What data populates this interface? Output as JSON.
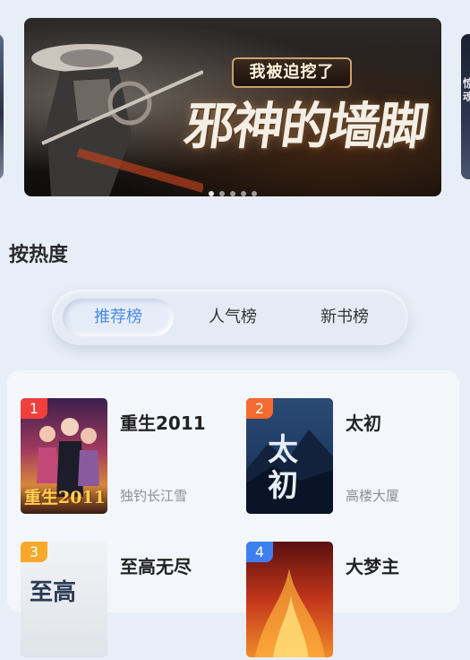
{
  "banner": {
    "subtitle": "我被迫挖了",
    "title": "邪神的墙脚",
    "slide_count": 5,
    "active_slide": 0
  },
  "peek_right_text": "惊魂",
  "section": {
    "title": "按热度"
  },
  "tabs": [
    {
      "label": "推荐榜",
      "active": true
    },
    {
      "label": "人气榜",
      "active": false
    },
    {
      "label": "新书榜",
      "active": false
    }
  ],
  "books": [
    {
      "rank": "1",
      "title": "重生2011",
      "author": "独钓长江雪",
      "cover_text": "重生2011"
    },
    {
      "rank": "2",
      "title": "太初",
      "author": "高楼大厦",
      "cover_text": "太初"
    },
    {
      "rank": "3",
      "title": "至高无尽",
      "author": "",
      "cover_text": "至高"
    },
    {
      "rank": "4",
      "title": "大梦主",
      "author": "",
      "cover_text": ""
    }
  ],
  "colors": {
    "accent": "#4a8be6",
    "rank1": "#f0403c",
    "rank2": "#f56a2f",
    "rank3": "#f6a92c",
    "rank4": "#3e7ff0"
  }
}
